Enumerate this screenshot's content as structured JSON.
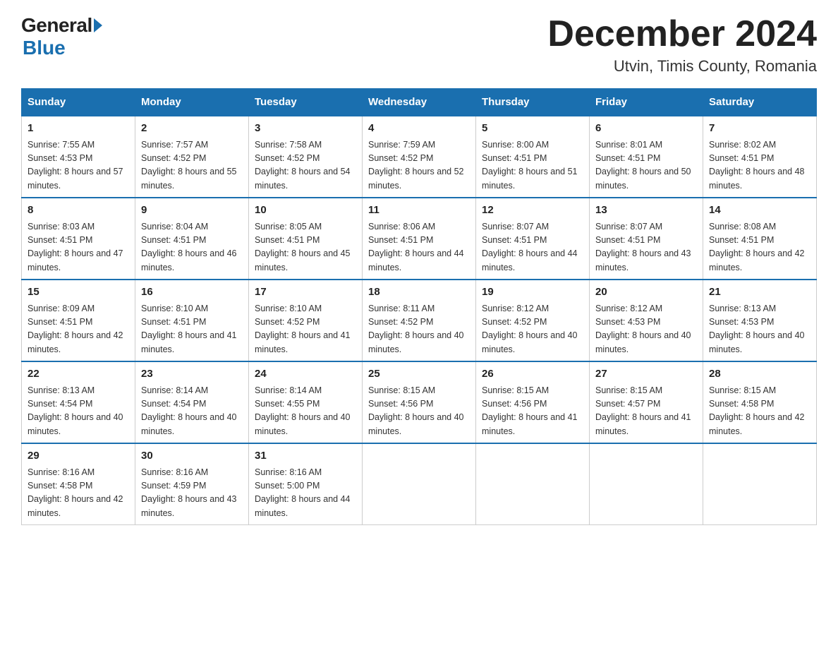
{
  "header": {
    "logo_general": "General",
    "logo_blue": "Blue",
    "month_title": "December 2024",
    "location": "Utvin, Timis County, Romania"
  },
  "weekdays": [
    "Sunday",
    "Monday",
    "Tuesday",
    "Wednesday",
    "Thursday",
    "Friday",
    "Saturday"
  ],
  "weeks": [
    [
      {
        "day": 1,
        "sunrise": "7:55 AM",
        "sunset": "4:53 PM",
        "daylight": "8 hours and 57 minutes."
      },
      {
        "day": 2,
        "sunrise": "7:57 AM",
        "sunset": "4:52 PM",
        "daylight": "8 hours and 55 minutes."
      },
      {
        "day": 3,
        "sunrise": "7:58 AM",
        "sunset": "4:52 PM",
        "daylight": "8 hours and 54 minutes."
      },
      {
        "day": 4,
        "sunrise": "7:59 AM",
        "sunset": "4:52 PM",
        "daylight": "8 hours and 52 minutes."
      },
      {
        "day": 5,
        "sunrise": "8:00 AM",
        "sunset": "4:51 PM",
        "daylight": "8 hours and 51 minutes."
      },
      {
        "day": 6,
        "sunrise": "8:01 AM",
        "sunset": "4:51 PM",
        "daylight": "8 hours and 50 minutes."
      },
      {
        "day": 7,
        "sunrise": "8:02 AM",
        "sunset": "4:51 PM",
        "daylight": "8 hours and 48 minutes."
      }
    ],
    [
      {
        "day": 8,
        "sunrise": "8:03 AM",
        "sunset": "4:51 PM",
        "daylight": "8 hours and 47 minutes."
      },
      {
        "day": 9,
        "sunrise": "8:04 AM",
        "sunset": "4:51 PM",
        "daylight": "8 hours and 46 minutes."
      },
      {
        "day": 10,
        "sunrise": "8:05 AM",
        "sunset": "4:51 PM",
        "daylight": "8 hours and 45 minutes."
      },
      {
        "day": 11,
        "sunrise": "8:06 AM",
        "sunset": "4:51 PM",
        "daylight": "8 hours and 44 minutes."
      },
      {
        "day": 12,
        "sunrise": "8:07 AM",
        "sunset": "4:51 PM",
        "daylight": "8 hours and 44 minutes."
      },
      {
        "day": 13,
        "sunrise": "8:07 AM",
        "sunset": "4:51 PM",
        "daylight": "8 hours and 43 minutes."
      },
      {
        "day": 14,
        "sunrise": "8:08 AM",
        "sunset": "4:51 PM",
        "daylight": "8 hours and 42 minutes."
      }
    ],
    [
      {
        "day": 15,
        "sunrise": "8:09 AM",
        "sunset": "4:51 PM",
        "daylight": "8 hours and 42 minutes."
      },
      {
        "day": 16,
        "sunrise": "8:10 AM",
        "sunset": "4:51 PM",
        "daylight": "8 hours and 41 minutes."
      },
      {
        "day": 17,
        "sunrise": "8:10 AM",
        "sunset": "4:52 PM",
        "daylight": "8 hours and 41 minutes."
      },
      {
        "day": 18,
        "sunrise": "8:11 AM",
        "sunset": "4:52 PM",
        "daylight": "8 hours and 40 minutes."
      },
      {
        "day": 19,
        "sunrise": "8:12 AM",
        "sunset": "4:52 PM",
        "daylight": "8 hours and 40 minutes."
      },
      {
        "day": 20,
        "sunrise": "8:12 AM",
        "sunset": "4:53 PM",
        "daylight": "8 hours and 40 minutes."
      },
      {
        "day": 21,
        "sunrise": "8:13 AM",
        "sunset": "4:53 PM",
        "daylight": "8 hours and 40 minutes."
      }
    ],
    [
      {
        "day": 22,
        "sunrise": "8:13 AM",
        "sunset": "4:54 PM",
        "daylight": "8 hours and 40 minutes."
      },
      {
        "day": 23,
        "sunrise": "8:14 AM",
        "sunset": "4:54 PM",
        "daylight": "8 hours and 40 minutes."
      },
      {
        "day": 24,
        "sunrise": "8:14 AM",
        "sunset": "4:55 PM",
        "daylight": "8 hours and 40 minutes."
      },
      {
        "day": 25,
        "sunrise": "8:15 AM",
        "sunset": "4:56 PM",
        "daylight": "8 hours and 40 minutes."
      },
      {
        "day": 26,
        "sunrise": "8:15 AM",
        "sunset": "4:56 PM",
        "daylight": "8 hours and 41 minutes."
      },
      {
        "day": 27,
        "sunrise": "8:15 AM",
        "sunset": "4:57 PM",
        "daylight": "8 hours and 41 minutes."
      },
      {
        "day": 28,
        "sunrise": "8:15 AM",
        "sunset": "4:58 PM",
        "daylight": "8 hours and 42 minutes."
      }
    ],
    [
      {
        "day": 29,
        "sunrise": "8:16 AM",
        "sunset": "4:58 PM",
        "daylight": "8 hours and 42 minutes."
      },
      {
        "day": 30,
        "sunrise": "8:16 AM",
        "sunset": "4:59 PM",
        "daylight": "8 hours and 43 minutes."
      },
      {
        "day": 31,
        "sunrise": "8:16 AM",
        "sunset": "5:00 PM",
        "daylight": "8 hours and 44 minutes."
      },
      null,
      null,
      null,
      null
    ]
  ]
}
